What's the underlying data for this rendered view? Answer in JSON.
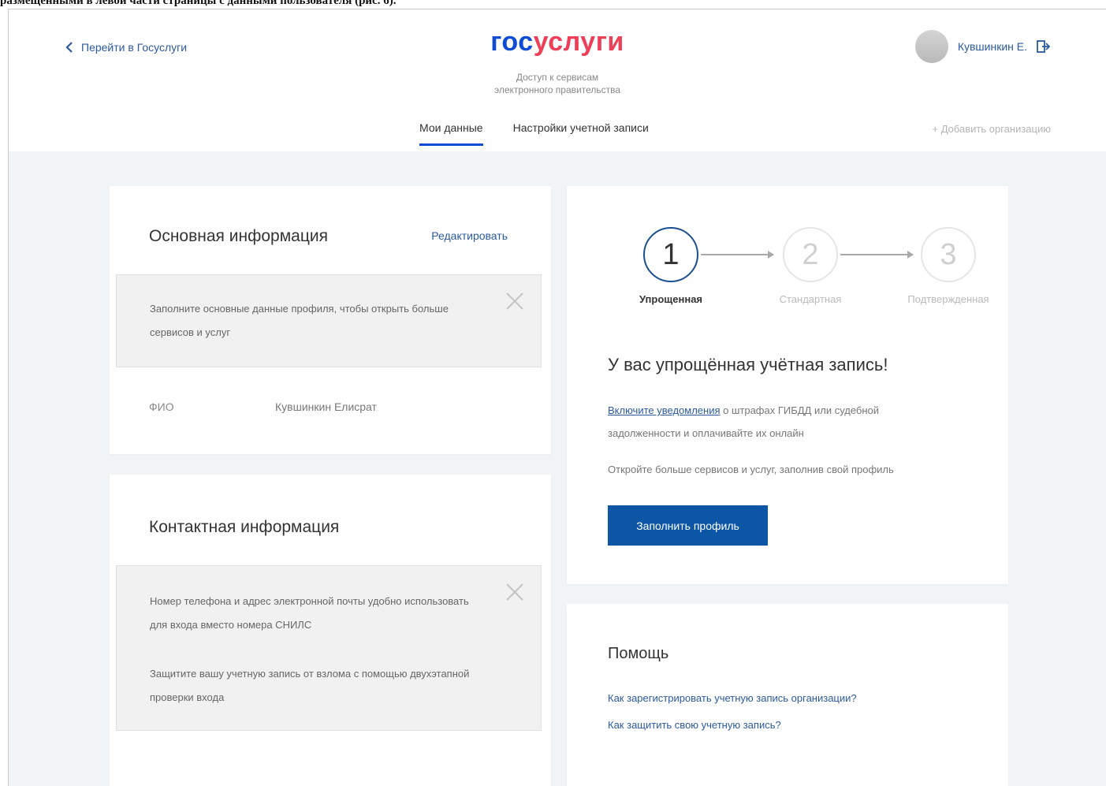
{
  "document": {
    "caption_fragment": "размещенными в левой части страницы с данными пользователя (рис. 6)."
  },
  "header": {
    "back_link": "Перейти в Госуслуги",
    "logo_part1": "гос",
    "logo_part2": "услуги",
    "tagline_line1": "Доступ к сервисам",
    "tagline_line2": "электронного правительства",
    "user_name": "Кувшинкин Е.",
    "tabs": [
      {
        "label": "Мои данные",
        "active": true
      },
      {
        "label": "Настройки учетной записи",
        "active": false
      }
    ],
    "add_org": "+ Добавить организацию"
  },
  "basic_info": {
    "title": "Основная информация",
    "edit_link": "Редактировать",
    "notice": "Заполните основные данные профиля, чтобы открыть больше сервисов и услуг",
    "fio_label": "ФИО",
    "fio_value": "Кувшинкин Елисрат"
  },
  "contact_info": {
    "title": "Контактная информация",
    "notice_1": "Номер телефона и адрес электронной почты удобно использовать для входа вместо номера СНИЛС",
    "notice_2": "Защитите вашу учетную запись от взлома с помощью двухэтапной проверки входа"
  },
  "account_status": {
    "steps": [
      {
        "number": "1",
        "label": "Упрощенная",
        "active": true
      },
      {
        "number": "2",
        "label": "Стандартная",
        "active": false
      },
      {
        "number": "3",
        "label": "Подтвержденная",
        "active": false
      }
    ],
    "title": "У вас упрощённая учётная запись!",
    "desc_link": "Включите уведомления",
    "desc_rest": " о штрафах ГИБДД или судебной задолженности и оплачивайте их онлайн",
    "desc2": "Откройте больше сервисов и услуг, заполнив свой профиль",
    "button": "Заполнить профиль"
  },
  "help": {
    "title": "Помощь",
    "link_1": "Как зарегистрировать учетную запись организации?",
    "link_2": "Как защитить свою учетную запись?"
  },
  "colors": {
    "brand_blue": "#0d4cd3",
    "brand_red": "#ee3f58",
    "button": "#0d56a6",
    "link": "#2c5aa0",
    "background": "#f1f4f6"
  }
}
